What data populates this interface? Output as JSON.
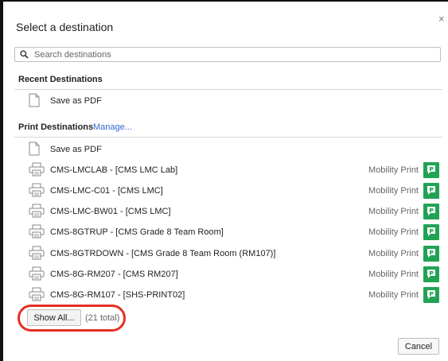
{
  "dialog": {
    "title": "Select a destination",
    "close_glyph": "×"
  },
  "search": {
    "placeholder": "Search destinations",
    "value": "",
    "icon": "search-icon"
  },
  "recent": {
    "heading": "Recent Destinations",
    "items": [
      {
        "label": "Save as PDF",
        "icon": "document-icon"
      }
    ]
  },
  "print_destinations": {
    "heading": "Print Destinations",
    "manage_label": "Manage...",
    "items": [
      {
        "label": "Save as PDF",
        "icon": "document-icon",
        "provider": ""
      },
      {
        "label": "CMS-LMCLAB - [CMS LMC Lab]",
        "icon": "printer-icon",
        "provider": "Mobility Print"
      },
      {
        "label": "CMS-LMC-C01 - [CMS LMC]",
        "icon": "printer-icon",
        "provider": "Mobility Print"
      },
      {
        "label": "CMS-LMC-BW01 - [CMS LMC]",
        "icon": "printer-icon",
        "provider": "Mobility Print"
      },
      {
        "label": "CMS-8GTRUP - [CMS Grade 8 Team Room]",
        "icon": "printer-icon",
        "provider": "Mobility Print"
      },
      {
        "label": "CMS-8GTRDOWN - [CMS Grade 8 Team Room (RM107)]",
        "icon": "printer-icon",
        "provider": "Mobility Print"
      },
      {
        "label": "CMS-8G-RM207 - [CMS RM207]",
        "icon": "printer-icon",
        "provider": "Mobility Print"
      },
      {
        "label": "CMS-8G-RM107 - [SHS-PRINT02]",
        "icon": "printer-icon",
        "provider": "Mobility Print"
      }
    ]
  },
  "footer": {
    "show_all_label": "Show All...",
    "total_label": "(21 total)",
    "cancel_label": "Cancel"
  },
  "colors": {
    "accent_link": "#3367d6",
    "mobility_badge": "#21a355",
    "highlight_ring": "#e62e24"
  }
}
